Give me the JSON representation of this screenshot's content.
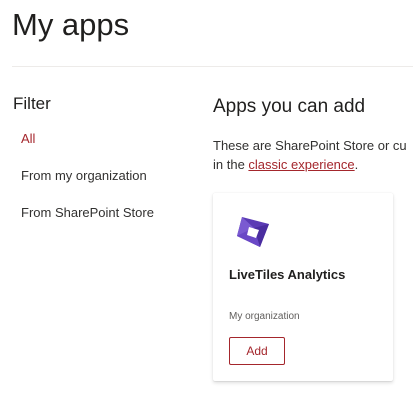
{
  "page": {
    "title": "My apps"
  },
  "filter": {
    "heading": "Filter",
    "items": [
      {
        "label": "All",
        "active": true
      },
      {
        "label": "From my organization",
        "active": false
      },
      {
        "label": "From SharePoint Store",
        "active": false
      }
    ]
  },
  "main": {
    "heading": "Apps you can add",
    "description_line1": "These are SharePoint Store or cu",
    "description_line2_prefix": "in the ",
    "description_link": "classic experience",
    "description_line2_suffix": "."
  },
  "apps": [
    {
      "name": "LiveTiles Analytics",
      "source": "My organization",
      "add_label": "Add",
      "icon": "livetiles-logo-icon",
      "icon_color": "#5b3bb5"
    }
  ],
  "colors": {
    "accent": "#a4262c",
    "text": "#323130",
    "heading": "#201f1e",
    "divider": "#edebe9"
  }
}
